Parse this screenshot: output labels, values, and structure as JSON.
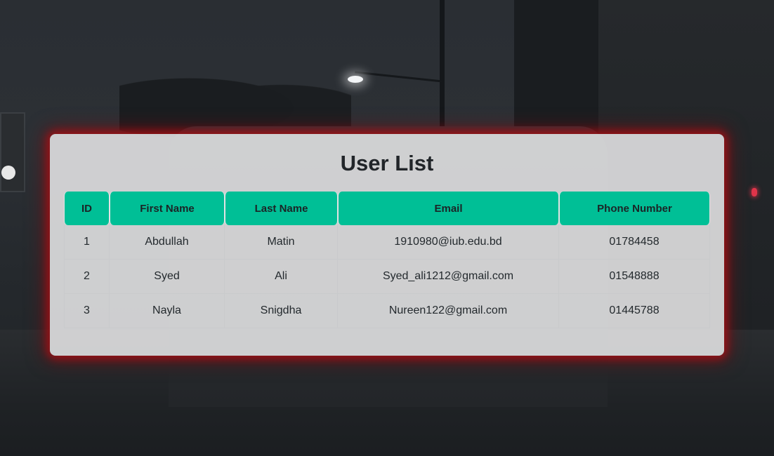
{
  "page": {
    "title": "User List"
  },
  "table": {
    "columns": [
      "ID",
      "First Name",
      "Last Name",
      "Email",
      "Phone Number"
    ],
    "rows": [
      [
        "1",
        "Abdullah",
        "Matin",
        "1910980@iub.edu.bd",
        "01784458"
      ],
      [
        "2",
        "Syed",
        "Ali",
        "Syed_ali1212@gmail.com",
        "01548888"
      ],
      [
        "3",
        "Nayla",
        "Snigdha",
        "Nureen122@gmail.com",
        "01445788"
      ]
    ]
  },
  "colors": {
    "header_bg": "#00bf96",
    "card_glow": "#aa0f14",
    "card_bg": "#e1e1e2"
  }
}
